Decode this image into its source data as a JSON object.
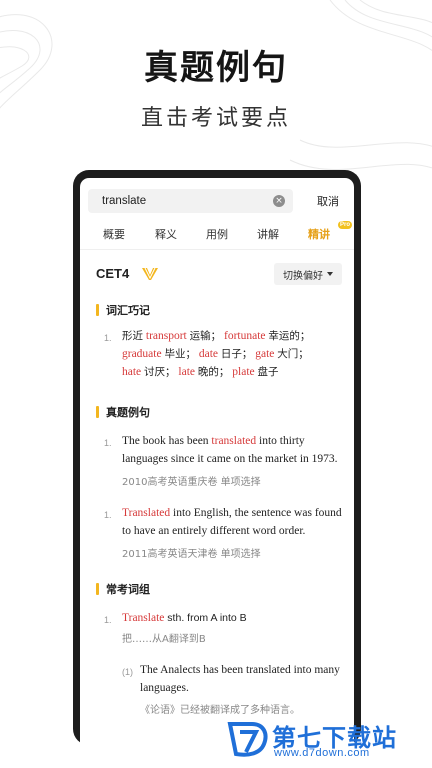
{
  "promo": {
    "title": "真题例句",
    "subtitle": "直击考试要点"
  },
  "search": {
    "value": "translate",
    "clear_icon": "clear-circle-icon",
    "cancel_label": "取消"
  },
  "tabs": [
    {
      "label": "概要",
      "active": false
    },
    {
      "label": "释义",
      "active": false
    },
    {
      "label": "用例",
      "active": false
    },
    {
      "label": "讲解",
      "active": false
    },
    {
      "label": "精讲",
      "active": true,
      "badge": "Pro"
    }
  ],
  "level": {
    "label": "CET4",
    "icon": "v-badge-icon",
    "preference_label": "切换偏好"
  },
  "sections": {
    "mnemonic": {
      "title": "词汇巧记",
      "items": [
        {
          "num": "1.",
          "prefix": "形近",
          "pairs": [
            {
              "word": "transport",
              "meaning": "运输；"
            },
            {
              "word": "fortunate",
              "meaning": "幸运的；"
            },
            {
              "word": "graduate",
              "meaning": "毕业；"
            },
            {
              "word": "date",
              "meaning": "日子；"
            },
            {
              "word": "gate",
              "meaning": "大门；"
            },
            {
              "word": "hate",
              "meaning": "讨厌；"
            },
            {
              "word": "late",
              "meaning": "晚的；"
            },
            {
              "word": "plate",
              "meaning": "盘子"
            }
          ]
        }
      ]
    },
    "exam": {
      "title": "真题例句",
      "items": [
        {
          "num": "1.",
          "before": "The book has been ",
          "keyword": "translated",
          "after": " into thirty languages since it came on the market in 1973.",
          "source": "2010高考英语重庆卷 单项选择"
        },
        {
          "num": "1.",
          "before": "",
          "keyword": "Translated",
          "after": " into English, the sentence was found to have an entirely different word order.",
          "source": "2011高考英语天津卷 单项选择"
        }
      ]
    },
    "phrases": {
      "title": "常考词组",
      "items": [
        {
          "num": "1.",
          "keyword": "Translate",
          "rest": " sth. from A into B",
          "meaning": "把……从A翻译到B",
          "example": {
            "num": "(1)",
            "text": "The Analects has been translated into many languages.",
            "translation": "《论语》已经被翻译成了多种语言。"
          }
        }
      ]
    }
  },
  "watermark": {
    "title": "第七下载站",
    "url": "www.d7down.com",
    "logo_icon": "d7-logo-icon"
  },
  "colors": {
    "accent": "#f3b61f",
    "keyword": "#d63a3a",
    "active_tab": "#e6a11a",
    "watermark": "#1f6fd8"
  }
}
